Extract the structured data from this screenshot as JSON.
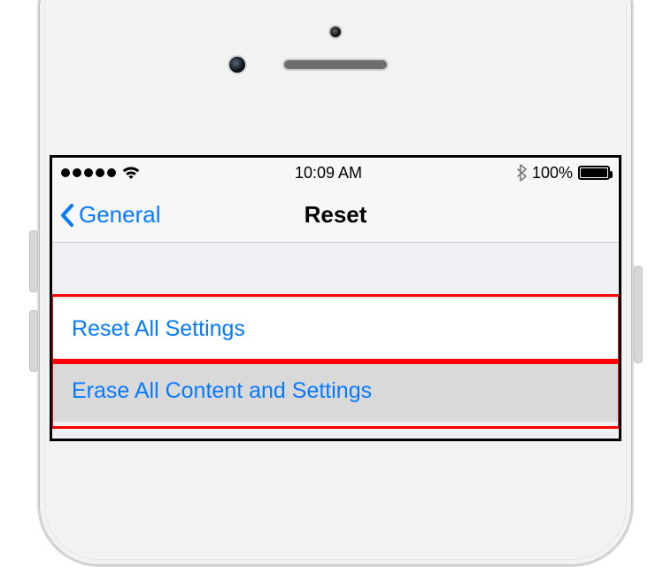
{
  "status_bar": {
    "time": "10:09 AM",
    "battery_text": "100%",
    "battery_level": 100,
    "bluetooth": true,
    "wifi": true,
    "cell_dots_filled": 5
  },
  "nav": {
    "back_label": "General",
    "title": "Reset"
  },
  "menu": {
    "items": [
      {
        "label": "Reset All Settings",
        "pressed": false
      },
      {
        "label": "Erase All Content and Settings",
        "pressed": true
      }
    ]
  }
}
